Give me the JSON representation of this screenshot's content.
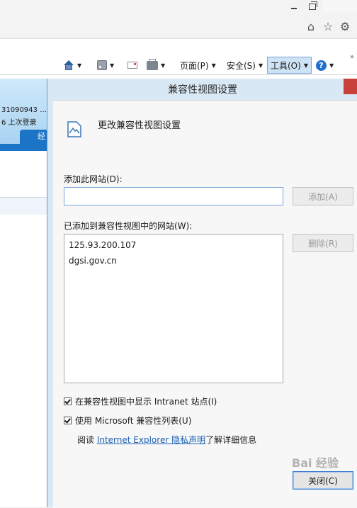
{
  "browser": {
    "command_bar": {
      "page_label": "页面(P)",
      "safety_label": "安全(S)",
      "tools_label": "工具(O)",
      "help_icon_glyph": "?"
    }
  },
  "background_page": {
    "line1": "31090943  …",
    "line2": "6  上次登录",
    "tab_label": "经"
  },
  "dialog": {
    "title": "兼容性视图设置",
    "header_text": "更改兼容性视图设置",
    "add_site_label": "添加此网站(D):",
    "add_site_value": "",
    "add_button": "添加(A)",
    "list_label": "已添加到兼容性视图中的网站(W):",
    "sites": [
      "125.93.200.107",
      "dgsi.gov.cn"
    ],
    "remove_button": "删除(R)",
    "checkbox_intranet": "在兼容性视图中显示 Intranet 站点(I)",
    "checkbox_intranet_checked": true,
    "checkbox_ms_list": "使用 Microsoft 兼容性列表(U)",
    "checkbox_ms_list_checked": true,
    "info_prefix": "阅读 ",
    "info_link": "Internet Explorer 隐私声明",
    "info_suffix": "了解详细信息",
    "close_button": "关闭(C)"
  },
  "colors": {
    "dialog_frame": "#d9e8f5",
    "link": "#1a5fb4",
    "tools_highlight": "#cfe3f7",
    "close_red": "#c9413b"
  },
  "watermark": "Bai 经验"
}
